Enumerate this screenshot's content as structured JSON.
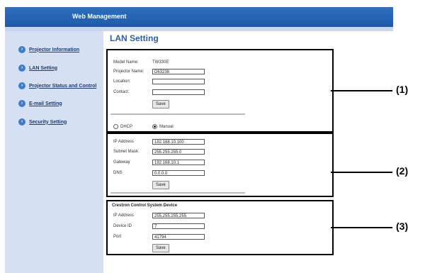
{
  "header": {
    "title": "Web Management"
  },
  "sidebar": {
    "items": [
      {
        "label": "Projector Information"
      },
      {
        "label": "LAN Setting"
      },
      {
        "label": "Projector Status and Control"
      },
      {
        "label": "E-mail Setting"
      },
      {
        "label": "Security Setting"
      }
    ]
  },
  "page": {
    "title": "LAN Setting"
  },
  "section1": {
    "model_label": "Model Name:",
    "model_value": "TW330E",
    "projector_label": "Projector Name:",
    "projector_value": "D63238",
    "location_label": "Location:",
    "location_value": "",
    "contact_label": "Contact:",
    "contact_value": "",
    "save_label": "Save",
    "dhcp_label": "DHCP",
    "manual_label": "Manual",
    "selected_mode": "Manual"
  },
  "section2": {
    "ip_label": "IP Address",
    "ip_value": "192.168.10.100",
    "subnet_label": "Subnet Mask",
    "subnet_value": "255.255.255.0",
    "gateway_label": "Gateway",
    "gateway_value": "192.168.10.1",
    "dns_label": "DNS",
    "dns_value": "0.0.0.0",
    "save_label": "Save"
  },
  "section3": {
    "heading": "Crestron Control System Device",
    "ip_label": "IP Address",
    "ip_value": "255.255.255.255",
    "device_label": "Device ID",
    "device_value": "7",
    "port_label": "Port",
    "port_value": "41794",
    "save_label": "Save"
  },
  "annotations": {
    "one": "(1)",
    "two": "(2)",
    "three": "(3)"
  }
}
